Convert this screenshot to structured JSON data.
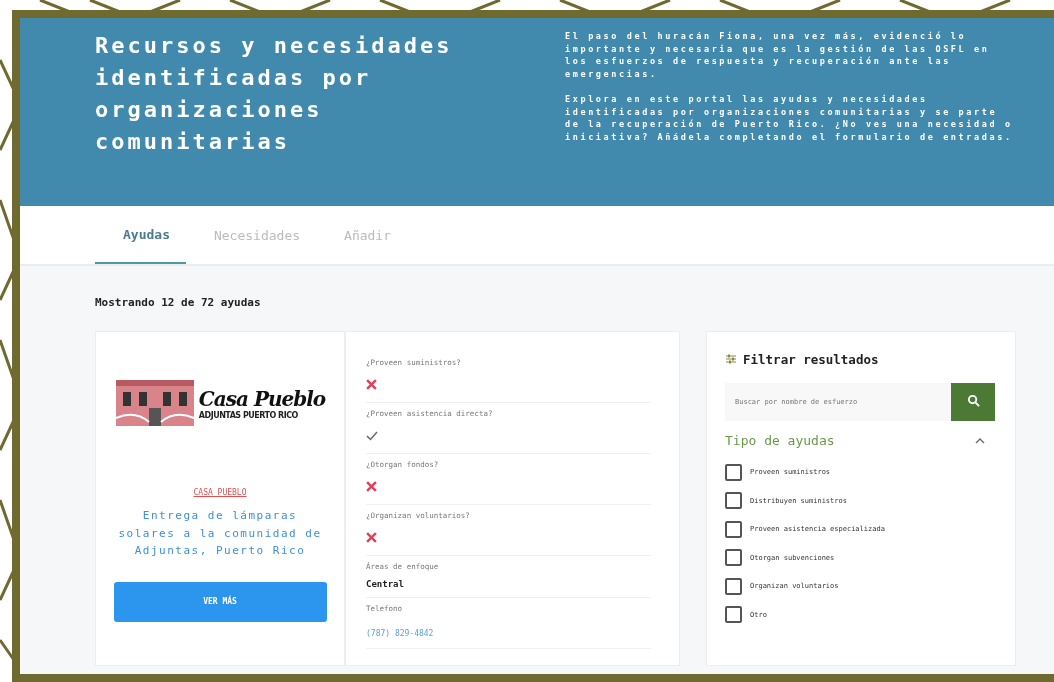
{
  "header": {
    "title": "Recursos y necesidades identificadas por organizaciones comunitarias",
    "intro": [
      "El paso del huracán Fiona, una vez más, evidenció lo importante y necesaria que es la gestión de las OSFL en los esfuerzos de respuesta y recuperación ante las emergencias.",
      "Explora en este portal las ayudas y necesidades identificadas por organizaciones comunitarias y se parte de la recuperación de Puerto Rico. ¿No ves una necesidad o iniciativa? Añádela completando el formulario de entradas."
    ]
  },
  "tabs": [
    {
      "label": "Ayudas",
      "selected": true
    },
    {
      "label": "Necesidades",
      "selected": false
    },
    {
      "label": "Añadir",
      "selected": false
    }
  ],
  "results_count": "Mostrando 12 de 72 ayudas",
  "card": {
    "logo": {
      "name": "Casa Pueblo",
      "subtitle": "ADJUNTAS PUERTO RICO"
    },
    "organization": "CASA PUEBLO",
    "title": "Entrega de lámparas solares a la comunidad de Adjuntas, Puerto Rico",
    "button": "VER MÁS"
  },
  "details": [
    {
      "label": "¿Proveen suministros?",
      "kind": "answer",
      "answer": false
    },
    {
      "label": "¿Proveen asistencia directa?",
      "kind": "answer",
      "answer": true
    },
    {
      "label": "¿Otorgan fondos?",
      "kind": "answer",
      "answer": false
    },
    {
      "label": "¿Organizan voluntarios?",
      "kind": "answer",
      "answer": false
    },
    {
      "label": "Áreas de enfoque",
      "kind": "text",
      "value": "Central"
    },
    {
      "label": "Telefono",
      "kind": "link",
      "value": "(787) 829-4842"
    }
  ],
  "filters": {
    "title": "Filtrar resultados",
    "search": {
      "placeholder": "Buscar por nombre de esfuerzo"
    },
    "section": {
      "title": "Tipo de ayudas",
      "expanded": true,
      "options": [
        {
          "label": "Proveen suministros",
          "checked": false
        },
        {
          "label": "Distribuyen suministros",
          "checked": false
        },
        {
          "label": "Proveen asistencia especializada",
          "checked": false
        },
        {
          "label": "Otorgan subvenciones",
          "checked": false
        },
        {
          "label": "Organizan voluntarios",
          "checked": false
        },
        {
          "label": "Otro",
          "checked": false
        }
      ]
    }
  }
}
